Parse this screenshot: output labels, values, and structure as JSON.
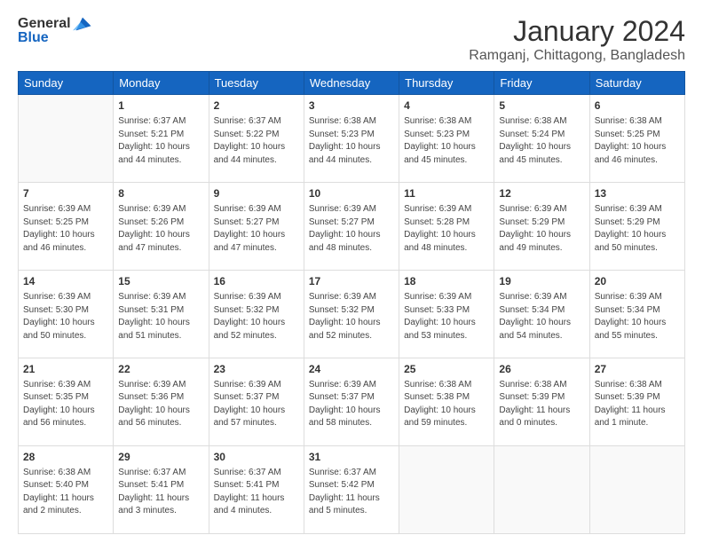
{
  "header": {
    "logo_general": "General",
    "logo_blue": "Blue",
    "month_year": "January 2024",
    "location": "Ramganj, Chittagong, Bangladesh"
  },
  "days": [
    "Sunday",
    "Monday",
    "Tuesday",
    "Wednesday",
    "Thursday",
    "Friday",
    "Saturday"
  ],
  "weeks": [
    [
      {
        "date": "",
        "sunrise": "",
        "sunset": "",
        "daylight": "",
        "empty": true
      },
      {
        "date": "1",
        "sunrise": "Sunrise: 6:37 AM",
        "sunset": "Sunset: 5:21 PM",
        "daylight": "Daylight: 10 hours and 44 minutes."
      },
      {
        "date": "2",
        "sunrise": "Sunrise: 6:37 AM",
        "sunset": "Sunset: 5:22 PM",
        "daylight": "Daylight: 10 hours and 44 minutes."
      },
      {
        "date": "3",
        "sunrise": "Sunrise: 6:38 AM",
        "sunset": "Sunset: 5:23 PM",
        "daylight": "Daylight: 10 hours and 44 minutes."
      },
      {
        "date": "4",
        "sunrise": "Sunrise: 6:38 AM",
        "sunset": "Sunset: 5:23 PM",
        "daylight": "Daylight: 10 hours and 45 minutes."
      },
      {
        "date": "5",
        "sunrise": "Sunrise: 6:38 AM",
        "sunset": "Sunset: 5:24 PM",
        "daylight": "Daylight: 10 hours and 45 minutes."
      },
      {
        "date": "6",
        "sunrise": "Sunrise: 6:38 AM",
        "sunset": "Sunset: 5:25 PM",
        "daylight": "Daylight: 10 hours and 46 minutes."
      }
    ],
    [
      {
        "date": "7",
        "sunrise": "Sunrise: 6:39 AM",
        "sunset": "Sunset: 5:25 PM",
        "daylight": "Daylight: 10 hours and 46 minutes."
      },
      {
        "date": "8",
        "sunrise": "Sunrise: 6:39 AM",
        "sunset": "Sunset: 5:26 PM",
        "daylight": "Daylight: 10 hours and 47 minutes."
      },
      {
        "date": "9",
        "sunrise": "Sunrise: 6:39 AM",
        "sunset": "Sunset: 5:27 PM",
        "daylight": "Daylight: 10 hours and 47 minutes."
      },
      {
        "date": "10",
        "sunrise": "Sunrise: 6:39 AM",
        "sunset": "Sunset: 5:27 PM",
        "daylight": "Daylight: 10 hours and 48 minutes."
      },
      {
        "date": "11",
        "sunrise": "Sunrise: 6:39 AM",
        "sunset": "Sunset: 5:28 PM",
        "daylight": "Daylight: 10 hours and 48 minutes."
      },
      {
        "date": "12",
        "sunrise": "Sunrise: 6:39 AM",
        "sunset": "Sunset: 5:29 PM",
        "daylight": "Daylight: 10 hours and 49 minutes."
      },
      {
        "date": "13",
        "sunrise": "Sunrise: 6:39 AM",
        "sunset": "Sunset: 5:29 PM",
        "daylight": "Daylight: 10 hours and 50 minutes."
      }
    ],
    [
      {
        "date": "14",
        "sunrise": "Sunrise: 6:39 AM",
        "sunset": "Sunset: 5:30 PM",
        "daylight": "Daylight: 10 hours and 50 minutes."
      },
      {
        "date": "15",
        "sunrise": "Sunrise: 6:39 AM",
        "sunset": "Sunset: 5:31 PM",
        "daylight": "Daylight: 10 hours and 51 minutes."
      },
      {
        "date": "16",
        "sunrise": "Sunrise: 6:39 AM",
        "sunset": "Sunset: 5:32 PM",
        "daylight": "Daylight: 10 hours and 52 minutes."
      },
      {
        "date": "17",
        "sunrise": "Sunrise: 6:39 AM",
        "sunset": "Sunset: 5:32 PM",
        "daylight": "Daylight: 10 hours and 52 minutes."
      },
      {
        "date": "18",
        "sunrise": "Sunrise: 6:39 AM",
        "sunset": "Sunset: 5:33 PM",
        "daylight": "Daylight: 10 hours and 53 minutes."
      },
      {
        "date": "19",
        "sunrise": "Sunrise: 6:39 AM",
        "sunset": "Sunset: 5:34 PM",
        "daylight": "Daylight: 10 hours and 54 minutes."
      },
      {
        "date": "20",
        "sunrise": "Sunrise: 6:39 AM",
        "sunset": "Sunset: 5:34 PM",
        "daylight": "Daylight: 10 hours and 55 minutes."
      }
    ],
    [
      {
        "date": "21",
        "sunrise": "Sunrise: 6:39 AM",
        "sunset": "Sunset: 5:35 PM",
        "daylight": "Daylight: 10 hours and 56 minutes."
      },
      {
        "date": "22",
        "sunrise": "Sunrise: 6:39 AM",
        "sunset": "Sunset: 5:36 PM",
        "daylight": "Daylight: 10 hours and 56 minutes."
      },
      {
        "date": "23",
        "sunrise": "Sunrise: 6:39 AM",
        "sunset": "Sunset: 5:37 PM",
        "daylight": "Daylight: 10 hours and 57 minutes."
      },
      {
        "date": "24",
        "sunrise": "Sunrise: 6:39 AM",
        "sunset": "Sunset: 5:37 PM",
        "daylight": "Daylight: 10 hours and 58 minutes."
      },
      {
        "date": "25",
        "sunrise": "Sunrise: 6:38 AM",
        "sunset": "Sunset: 5:38 PM",
        "daylight": "Daylight: 10 hours and 59 minutes."
      },
      {
        "date": "26",
        "sunrise": "Sunrise: 6:38 AM",
        "sunset": "Sunset: 5:39 PM",
        "daylight": "Daylight: 11 hours and 0 minutes."
      },
      {
        "date": "27",
        "sunrise": "Sunrise: 6:38 AM",
        "sunset": "Sunset: 5:39 PM",
        "daylight": "Daylight: 11 hours and 1 minute."
      }
    ],
    [
      {
        "date": "28",
        "sunrise": "Sunrise: 6:38 AM",
        "sunset": "Sunset: 5:40 PM",
        "daylight": "Daylight: 11 hours and 2 minutes."
      },
      {
        "date": "29",
        "sunrise": "Sunrise: 6:37 AM",
        "sunset": "Sunset: 5:41 PM",
        "daylight": "Daylight: 11 hours and 3 minutes."
      },
      {
        "date": "30",
        "sunrise": "Sunrise: 6:37 AM",
        "sunset": "Sunset: 5:41 PM",
        "daylight": "Daylight: 11 hours and 4 minutes."
      },
      {
        "date": "31",
        "sunrise": "Sunrise: 6:37 AM",
        "sunset": "Sunset: 5:42 PM",
        "daylight": "Daylight: 11 hours and 5 minutes."
      },
      {
        "date": "",
        "sunrise": "",
        "sunset": "",
        "daylight": "",
        "empty": true
      },
      {
        "date": "",
        "sunrise": "",
        "sunset": "",
        "daylight": "",
        "empty": true
      },
      {
        "date": "",
        "sunrise": "",
        "sunset": "",
        "daylight": "",
        "empty": true
      }
    ]
  ]
}
